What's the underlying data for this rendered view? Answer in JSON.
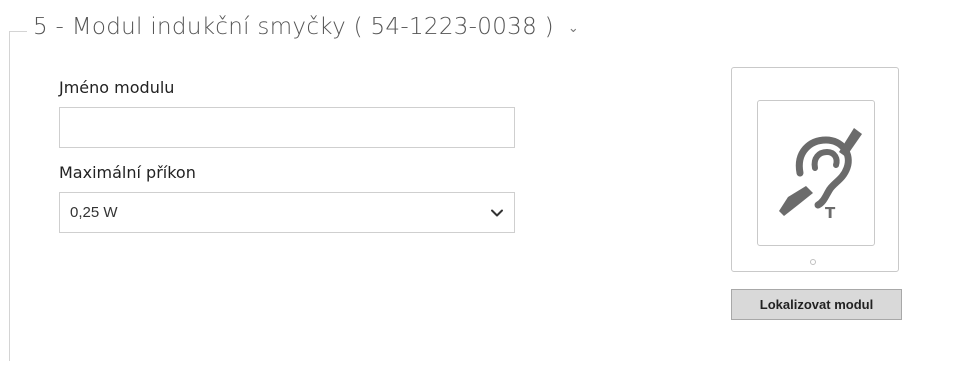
{
  "section": {
    "title": "5 - Modul indukční smyčky ( 54-1223-0038 )",
    "chevron_icon": "chevron-down-icon"
  },
  "form": {
    "module_name_label": "Jméno modulu",
    "module_name_value": "",
    "max_power_label": "Maximální příkon",
    "max_power_selected": "0,25 W"
  },
  "device": {
    "icon": "induction-loop-hearing-icon",
    "icon_letter": "T",
    "locate_button_label": "Lokalizovat modul"
  },
  "colors": {
    "icon_gray": "#6b6b6b",
    "border": "#cfcfcf",
    "button_bg": "#d9d9d9"
  }
}
